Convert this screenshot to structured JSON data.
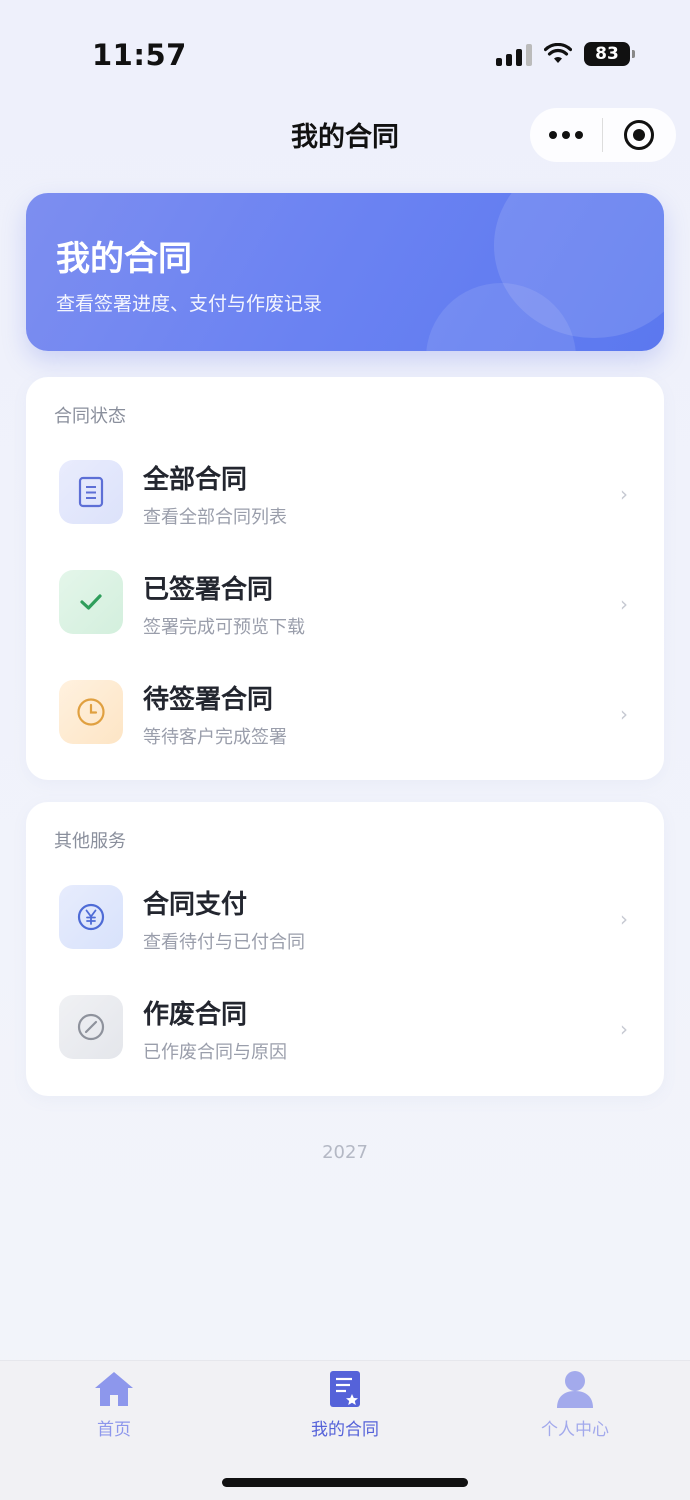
{
  "status_bar": {
    "time": "11:57",
    "battery": "83"
  },
  "nav": {
    "title": "我的合同"
  },
  "hero": {
    "title": "我的合同",
    "subtitle": "查看签署进度、支付与作废记录"
  },
  "status_section": {
    "label": "合同状态",
    "items": [
      {
        "title": "全部合同",
        "desc": "查看全部合同列表",
        "icon": "document-icon"
      },
      {
        "title": "已签署合同",
        "desc": "签署完成可预览下载",
        "icon": "check-icon"
      },
      {
        "title": "待签署合同",
        "desc": "等待客户完成签署",
        "icon": "clock-icon"
      }
    ]
  },
  "other_section": {
    "label": "其他服务",
    "items": [
      {
        "title": "合同支付",
        "desc": "查看待付与已付合同",
        "icon": "yen-icon"
      },
      {
        "title": "作废合同",
        "desc": "已作废合同与原因",
        "icon": "void-icon"
      }
    ]
  },
  "footer": {
    "year": "2027"
  },
  "tabbar": {
    "tabs": [
      {
        "label": "首页",
        "icon": "home-icon",
        "active": false
      },
      {
        "label": "我的合同",
        "icon": "contract-icon",
        "active": true
      },
      {
        "label": "个人中心",
        "icon": "user-icon",
        "active": false
      }
    ]
  },
  "colors": {
    "accent": "#5562d9",
    "hero_start": "#7d8ef0",
    "hero_end": "#5b78ef",
    "success": "#2f9e5b",
    "warning": "#e0a040"
  }
}
